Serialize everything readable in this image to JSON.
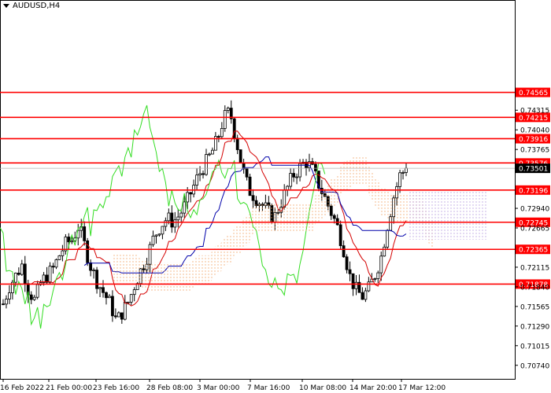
{
  "header": {
    "symbol": "AUDUSD,H4"
  },
  "colors": {
    "level_line": "#ff0000",
    "level_tag_bg": "#ff0000",
    "level_tag_text": "#ffffff",
    "current_tag_bg": "#000000",
    "current_tag_text": "#ffffff",
    "candle": "#000000",
    "tenkan": "#d40000",
    "kijun": "#0000aa",
    "chikou": "#33dd22",
    "cloud_bull": "#f0a060",
    "cloud_bear": "#b9a0e0"
  },
  "y_axis": {
    "range": [
      0.7055,
      0.7586
    ],
    "ticks": [
      "0.74315",
      "0.74040",
      "0.73765",
      "0.72940",
      "0.72665",
      "0.72115",
      "0.71840",
      "0.71565",
      "0.71290",
      "0.71015",
      "0.70740"
    ]
  },
  "levels": [
    "0.74565",
    "0.74215",
    "0.73916",
    "0.73576",
    "0.73196",
    "0.72745",
    "0.72365",
    "0.71878"
  ],
  "current_price": "0.73501",
  "x_axis": {
    "labels": [
      "16 Feb 2022",
      "21 Feb 00:00",
      "23 Feb 16:00",
      "28 Feb 08:00",
      "3 Mar 00:00",
      "7 Mar 16:00",
      "10 Mar 08:00",
      "14 Mar 20:00",
      "17 Mar 12:00"
    ]
  },
  "chart_data": {
    "type": "candlestick",
    "title": "AUDUSD,H4",
    "indicators": [
      "Ichimoku Kinko Hyo"
    ],
    "close_path": [
      0.716,
      0.7185,
      0.72,
      0.7215,
      0.718,
      0.7165,
      0.719,
      0.72,
      0.721,
      0.723,
      0.7245,
      0.725,
      0.727,
      0.724,
      0.721,
      0.719,
      0.7175,
      0.716,
      0.7135,
      0.715,
      0.7165,
      0.719,
      0.721,
      0.723,
      0.7255,
      0.727,
      0.728,
      0.7275,
      0.7285,
      0.73,
      0.732,
      0.734,
      0.7355,
      0.737,
      0.739,
      0.742,
      0.743,
      0.739,
      0.735,
      0.732,
      0.731,
      0.73,
      0.729,
      0.728,
      0.73,
      0.732,
      0.734,
      0.735,
      0.736,
      0.735,
      0.733,
      0.731,
      0.729,
      0.727,
      0.724,
      0.72,
      0.718,
      0.717,
      0.718,
      0.72,
      0.7225,
      0.727,
      0.731,
      0.734,
      0.735
    ],
    "current_price": 0.73501
  }
}
